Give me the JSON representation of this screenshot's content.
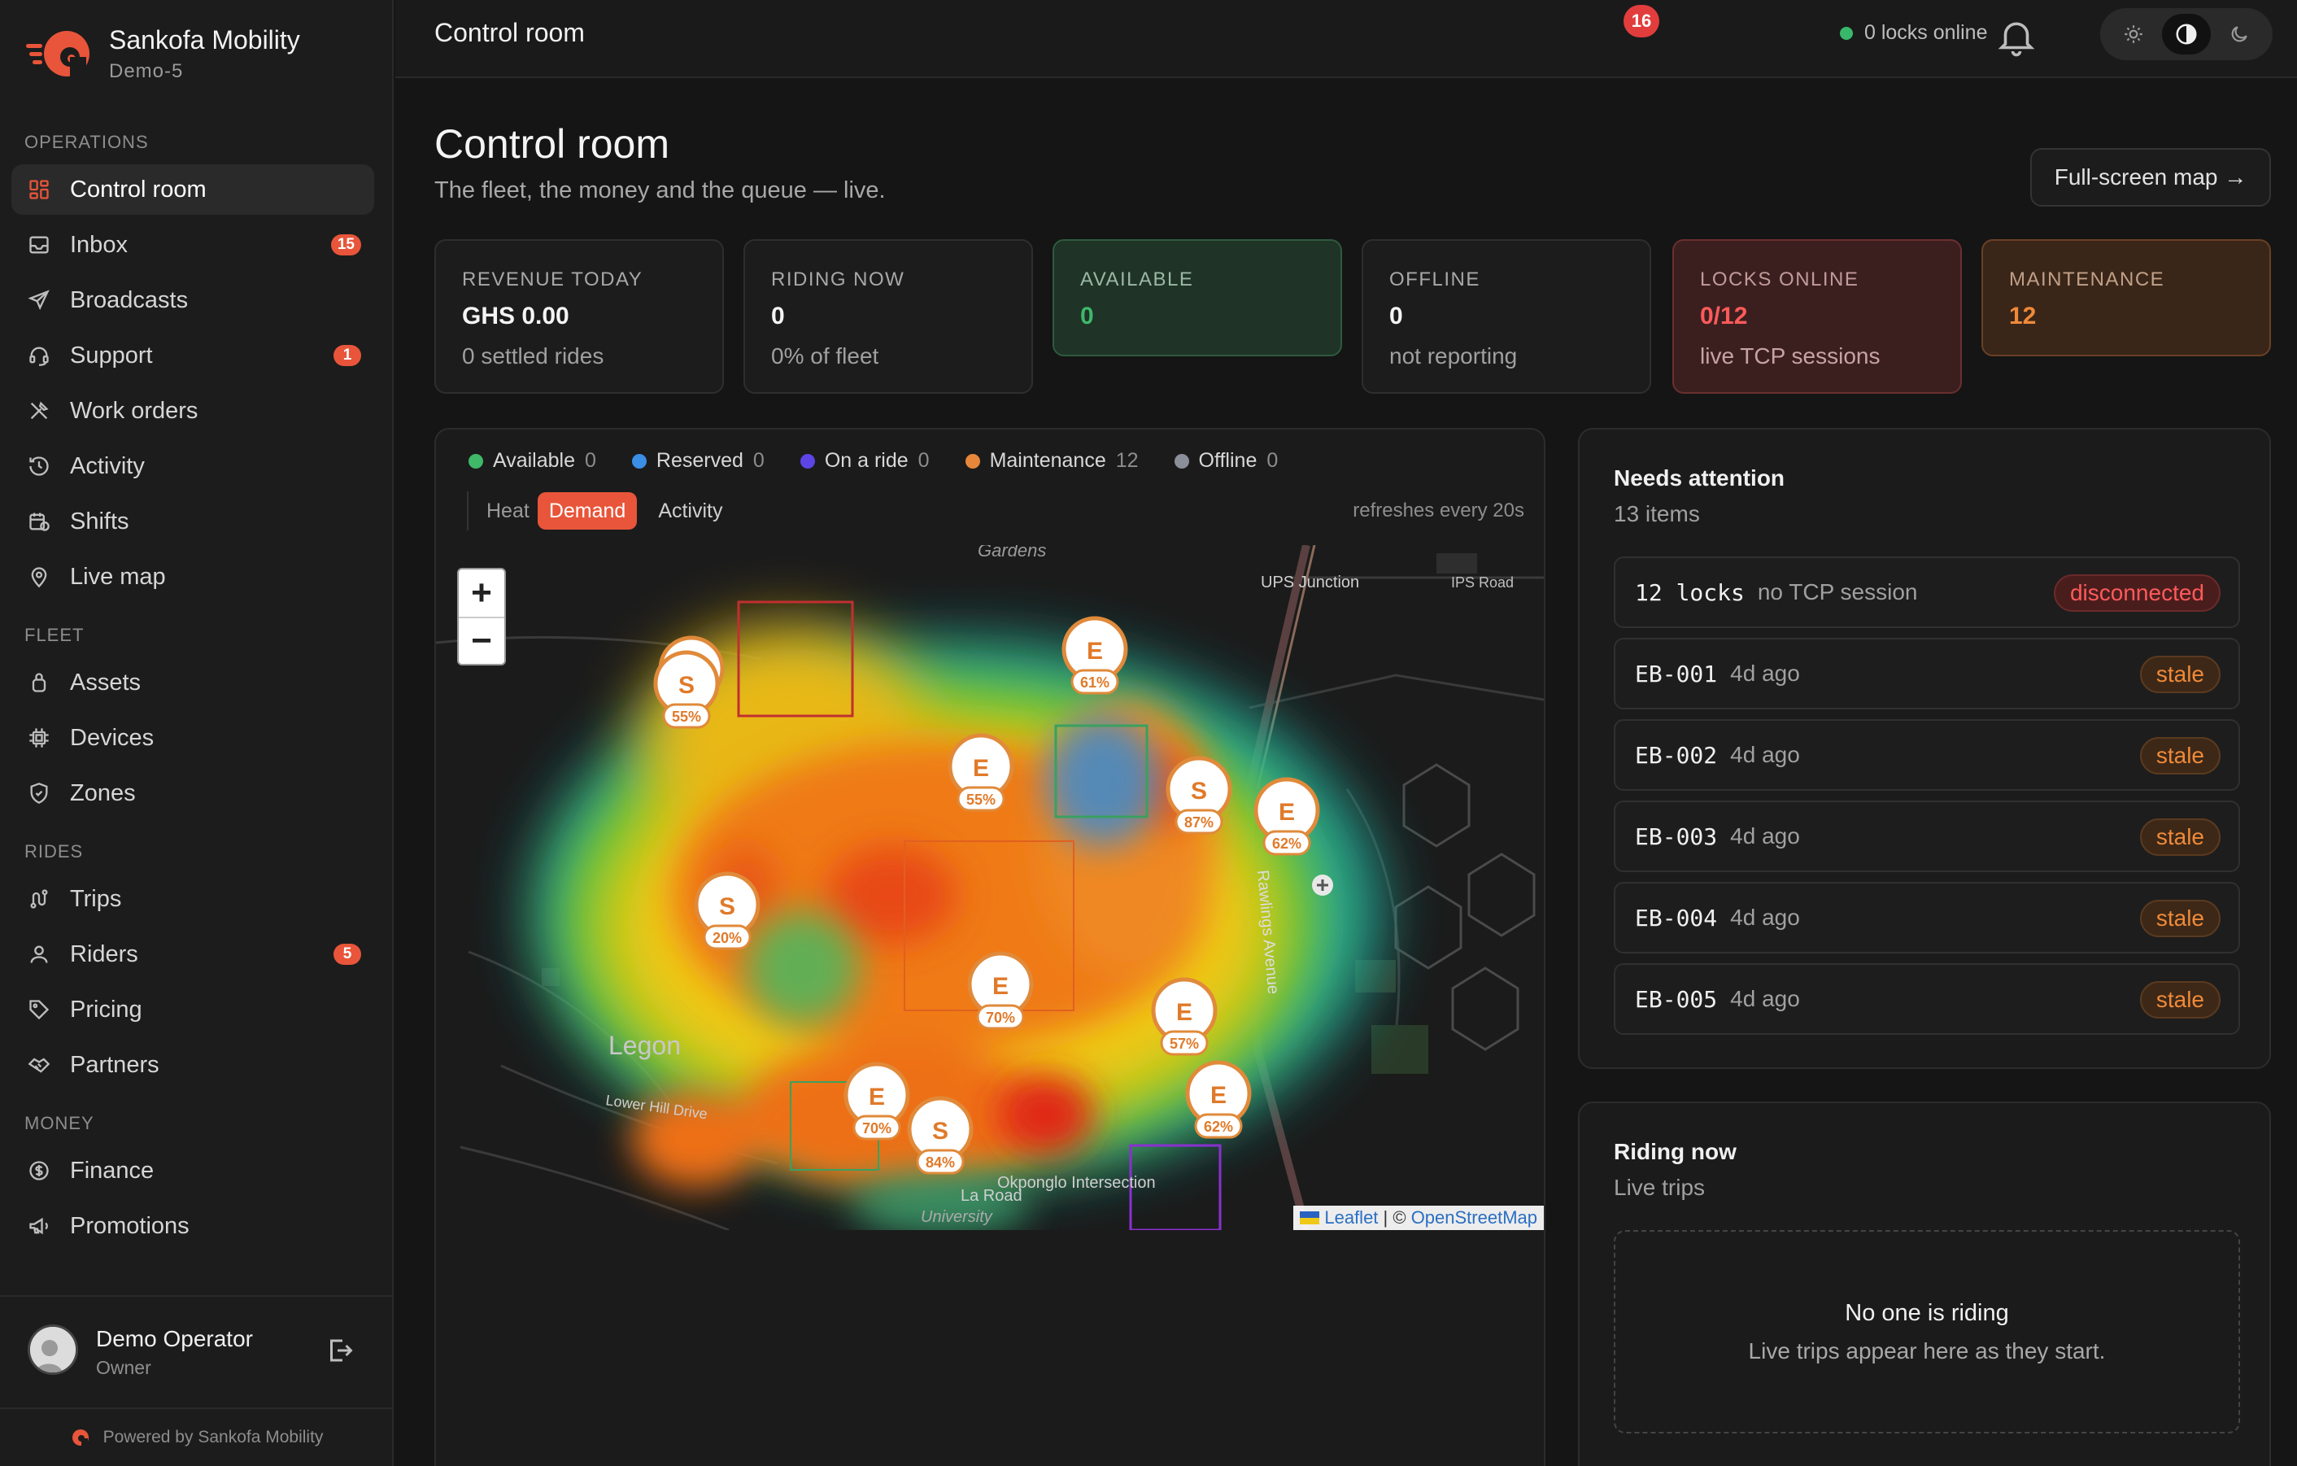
{
  "brand": {
    "name": "Sankofa Mobility",
    "sub": "Demo-5",
    "accent": "#e8553a"
  },
  "sidebar": {
    "sections": [
      {
        "title": "OPERATIONS",
        "items": [
          {
            "label": "Control room",
            "icon": "grid-icon",
            "active": true
          },
          {
            "label": "Inbox",
            "icon": "inbox-icon",
            "badge": "15"
          },
          {
            "label": "Broadcasts",
            "icon": "send-icon"
          },
          {
            "label": "Support",
            "icon": "headset-icon",
            "badge": "1"
          },
          {
            "label": "Work orders",
            "icon": "tools-icon"
          },
          {
            "label": "Activity",
            "icon": "history-icon"
          },
          {
            "label": "Shifts",
            "icon": "calendar-clock-icon"
          },
          {
            "label": "Live map",
            "icon": "map-pin-icon"
          }
        ]
      },
      {
        "title": "FLEET",
        "items": [
          {
            "label": "Assets",
            "icon": "scooter-icon"
          },
          {
            "label": "Devices",
            "icon": "chip-icon"
          },
          {
            "label": "Zones",
            "icon": "shield-icon"
          }
        ]
      },
      {
        "title": "RIDES",
        "items": [
          {
            "label": "Trips",
            "icon": "route-icon"
          },
          {
            "label": "Riders",
            "icon": "user-icon",
            "badge": "5"
          },
          {
            "label": "Pricing",
            "icon": "tag-icon"
          },
          {
            "label": "Partners",
            "icon": "handshake-icon"
          }
        ]
      },
      {
        "title": "MONEY",
        "items": [
          {
            "label": "Finance",
            "icon": "dollar-circle-icon"
          },
          {
            "label": "Promotions",
            "icon": "megaphone-icon"
          }
        ]
      }
    ],
    "user": {
      "name": "Demo Operator",
      "role": "Owner"
    },
    "powered": "Powered by Sankofa Mobility"
  },
  "topbar": {
    "title": "Control room",
    "locks_online": "0 locks online",
    "notifications": "16"
  },
  "page": {
    "title": "Control room",
    "subtitle": "The fleet, the money and the queue — live.",
    "fullscreen": "Full-screen map →"
  },
  "kpis": [
    {
      "label": "REVENUE TODAY",
      "value": "GHS 0.00",
      "note": "0 settled rides",
      "tone": "neutral"
    },
    {
      "label": "RIDING NOW",
      "value": "0",
      "note": "0% of fleet",
      "tone": "neutral"
    },
    {
      "label": "AVAILABLE",
      "value": "0",
      "note": "",
      "tone": "green"
    },
    {
      "label": "OFFLINE",
      "value": "0",
      "note": "not reporting",
      "tone": "neutral"
    },
    {
      "label": "LOCKS ONLINE",
      "value": "0/12",
      "note": "live TCP sessions",
      "tone": "red"
    },
    {
      "label": "MAINTENANCE",
      "value": "12",
      "note": "",
      "tone": "orange"
    }
  ],
  "map": {
    "legend": [
      {
        "label": "Available",
        "count": "0",
        "color": "#3fb868"
      },
      {
        "label": "Reserved",
        "count": "0",
        "color": "#3a8ee6"
      },
      {
        "label": "On a ride",
        "count": "0",
        "color": "#5b45e6"
      },
      {
        "label": "Maintenance",
        "count": "12",
        "color": "#e8873a"
      },
      {
        "label": "Offline",
        "count": "0",
        "color": "#8a8f99"
      }
    ],
    "modes": {
      "label": "Heat",
      "active": "Demand",
      "other": "Activity"
    },
    "refresh": "refreshes every 20s",
    "zoom_in": "+",
    "zoom_out": "−",
    "attribution": {
      "leaflet": "Leaflet",
      "sep": " | © ",
      "osm": "OpenStreetMap"
    },
    "place_labels": [
      "Gardens",
      "UPS Junction",
      "IPS Road",
      "Legon",
      "Lower Hill Drive",
      "La Road",
      "University",
      "Okponglo Intersection",
      "Rawlings Avenue"
    ],
    "markers": [
      {
        "letter": "S",
        "pct": "55%"
      },
      {
        "letter": "E",
        "pct": "61%"
      },
      {
        "letter": "E",
        "pct": "55%"
      },
      {
        "letter": "S",
        "pct": "87%"
      },
      {
        "letter": "E",
        "pct": "62%"
      },
      {
        "letter": "S",
        "pct": "20%"
      },
      {
        "letter": "E",
        "pct": "70%"
      },
      {
        "letter": "E",
        "pct": "57%"
      },
      {
        "letter": "E",
        "pct": "70%"
      },
      {
        "letter": "S",
        "pct": "84%"
      },
      {
        "letter": "E",
        "pct": "62%"
      }
    ]
  },
  "attention": {
    "title": "Needs attention",
    "count": "13 items",
    "rows": [
      {
        "id": "12 locks",
        "note": "no TCP session",
        "status": "disconnected",
        "tone": "red"
      },
      {
        "id": "EB-001",
        "note": "4d ago",
        "status": "stale",
        "tone": "orange"
      },
      {
        "id": "EB-002",
        "note": "4d ago",
        "status": "stale",
        "tone": "orange"
      },
      {
        "id": "EB-003",
        "note": "4d ago",
        "status": "stale",
        "tone": "orange"
      },
      {
        "id": "EB-004",
        "note": "4d ago",
        "status": "stale",
        "tone": "orange"
      },
      {
        "id": "EB-005",
        "note": "4d ago",
        "status": "stale",
        "tone": "orange"
      }
    ]
  },
  "riding": {
    "title": "Riding now",
    "subtitle": "Live trips",
    "empty_title": "No one is riding",
    "empty_sub": "Live trips appear here as they start."
  }
}
